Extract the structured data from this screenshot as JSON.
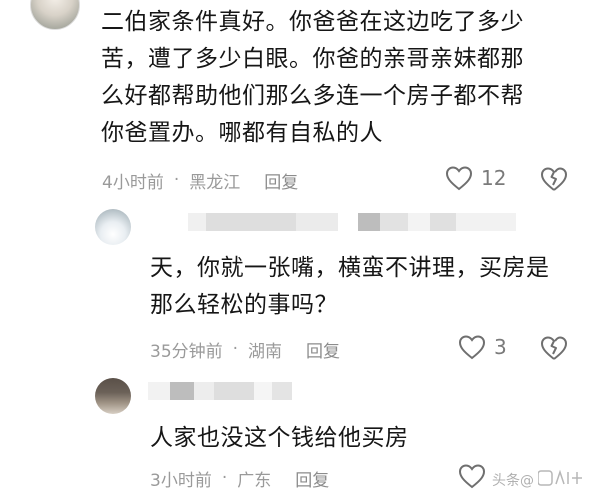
{
  "comments": [
    {
      "text_lines": [
        "二伯家条件真好。你爸爸在这边吃了多少",
        "苦，遭了多少白眼。你爸的亲哥亲妹都那",
        "么好都帮助他们那么多连一个房子都不帮",
        "你爸置办。哪都有自私的人"
      ],
      "time": "4小时前",
      "location": "黑龙江",
      "reply_label": "回复",
      "like_count": "12"
    },
    {
      "text_lines": [
        "天，你就一张嘴，横蛮不讲理，买房是",
        "那么轻松的事吗？"
      ],
      "time": "35分钟前",
      "location": "湖南",
      "reply_label": "回复",
      "like_count": "3"
    },
    {
      "text_lines": [
        "人家也没这个钱给他买房"
      ],
      "time": "3小时前",
      "location": "广东",
      "reply_label": "回复",
      "like_count": ""
    }
  ],
  "separator": "·",
  "watermark": "头条@",
  "colors": {
    "text": "#161616",
    "meta": "#9a9a9a",
    "icon": "#6f6f6f"
  },
  "icons": [
    "heart-outline-icon",
    "broken-heart-icon"
  ]
}
